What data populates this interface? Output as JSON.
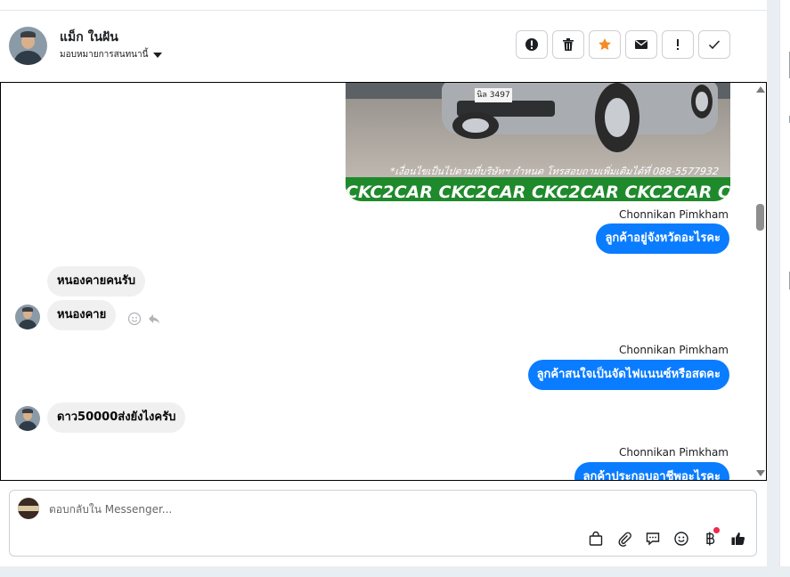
{
  "contact": {
    "name": "แม็ก ในฝัน",
    "assign_label": "มอบหมายการสนทนานี้"
  },
  "actions": [
    {
      "name": "report-spam",
      "icon": "exclamation-circle-icon"
    },
    {
      "name": "delete",
      "icon": "trash-icon"
    },
    {
      "name": "star",
      "icon": "star-icon",
      "color": "#f28c28"
    },
    {
      "name": "mark-unread",
      "icon": "envelope-icon"
    },
    {
      "name": "follow-up",
      "icon": "exclamation-icon"
    },
    {
      "name": "mark-done",
      "icon": "check-icon"
    }
  ],
  "image_attachment": {
    "plate_text": "นิล 3497",
    "watermark": "*เงื่อนไขเป็นไปตามที่บริษัทฯ กำหนด โทรสอบถามเพิ่มเติมได้ที่ 088-5577932",
    "banner": "CKC2CAR CKC2CAR CKC2CAR CKC2CAR CKC2"
  },
  "messages": [
    {
      "direction": "out",
      "sender": "Chonnikan Pimkham",
      "text": "ลูกค้าอยู่จังหวัดอะไรคะ"
    },
    {
      "direction": "in",
      "text": "หนองคายคนรับ"
    },
    {
      "direction": "in",
      "text": "หนองคาย"
    },
    {
      "direction": "out",
      "sender": "Chonnikan Pimkham",
      "text": "ลูกค้าสนใจเป็นจัดไฟแนนซ์หรือสดคะ"
    },
    {
      "direction": "in",
      "text": "ดาว50000ส่งยังไงครับ"
    },
    {
      "direction": "out",
      "sender": "Chonnikan Pimkham",
      "text": "ลูกค้าประกอบอาชีพอะไรคะ"
    }
  ],
  "composer": {
    "placeholder": "ตอบกลับใน Messenger...",
    "tools": [
      "shopping-bag-icon",
      "paperclip-icon",
      "saved-reply-icon",
      "emoji-icon",
      "baht-icon",
      "thumbs-up-icon"
    ]
  },
  "colors": {
    "outgoing_bubble": "#0a7cff",
    "incoming_bubble": "#f0f0f0",
    "notification_dot": "#f02849"
  }
}
